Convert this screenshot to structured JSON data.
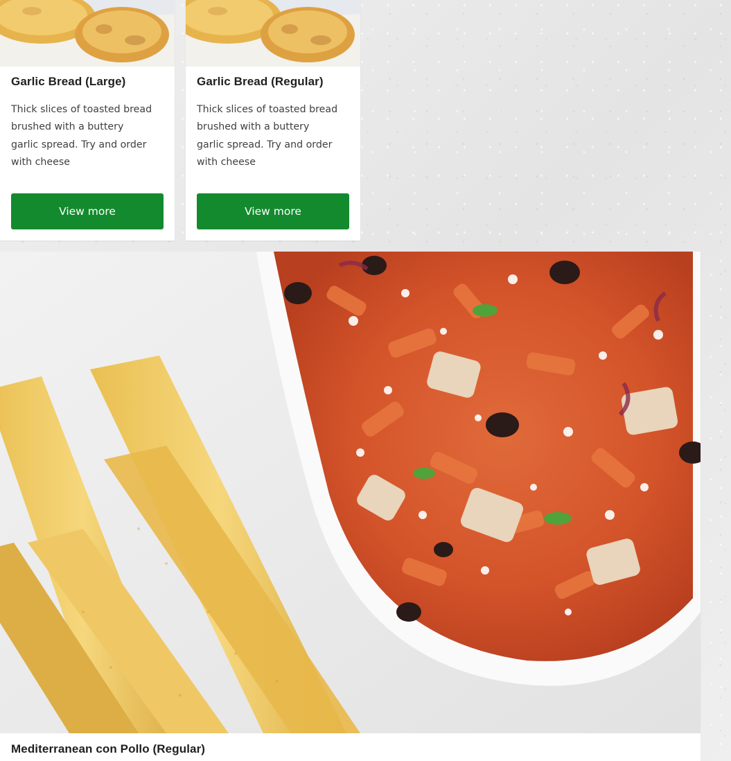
{
  "products": [
    {
      "title": "Garlic Bread (Large)",
      "description": "Thick slices of toasted bread brushed with a buttery garlic spread. Try and order with cheese",
      "button_label": "View more"
    },
    {
      "title": "Garlic Bread (Regular)",
      "description": "Thick slices of toasted bread brushed with a buttery garlic spread. Try and order with cheese",
      "button_label": "View more"
    },
    {
      "title": "Mediterranean con Pollo (Regular)"
    }
  ],
  "colors": {
    "button_bg": "#138a2e",
    "button_text": "#ffffff",
    "title_text": "#1f1f1f",
    "body_text": "#3f3f3f",
    "page_bg": "#ececec"
  }
}
